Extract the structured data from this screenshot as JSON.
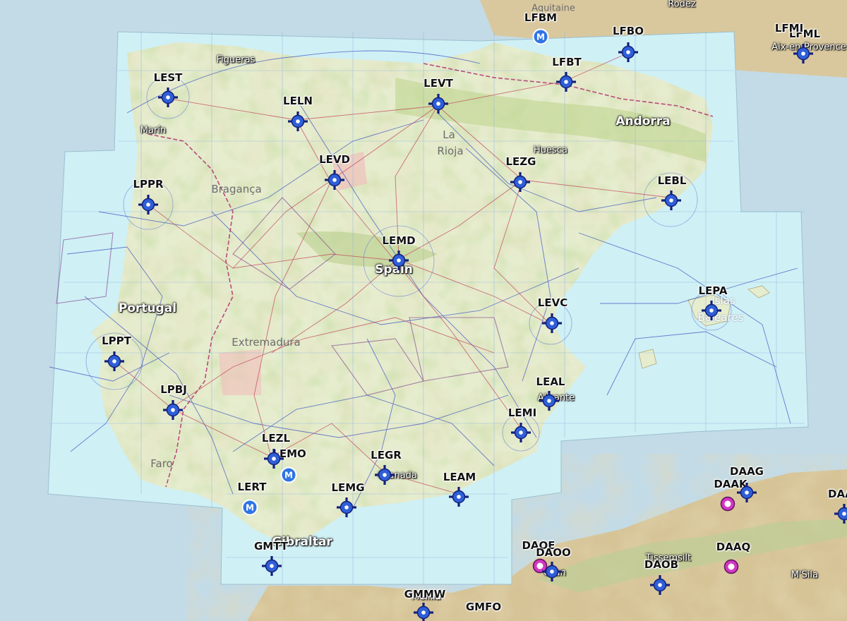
{
  "colors": {
    "sea": "#c3dbe6",
    "chart_sea": "#cff0f5",
    "chart_land": "#e3ebc9",
    "terrain": "#d8c595",
    "airport_blue": "#2f5fd8",
    "airport_magenta": "#d236c2",
    "country_border": "#b0306e",
    "airspace": "#3e55c2"
  },
  "airports": [
    {
      "id": "LEST",
      "icon": "airport-crosshair-icon"
    },
    {
      "id": "LELN",
      "icon": "airport-crosshair-icon"
    },
    {
      "id": "LEVT",
      "icon": "airport-crosshair-icon"
    },
    {
      "id": "LFBT",
      "icon": "airport-crosshair-icon"
    },
    {
      "id": "LFBO",
      "icon": "airport-crosshair-icon"
    },
    {
      "id": "LFBM",
      "icon": "military-airfield-icon"
    },
    {
      "id": "LFML",
      "icon": "airport-crosshair-icon"
    },
    {
      "id": "LFMI",
      "icon": ""
    },
    {
      "id": "LEVD",
      "icon": "airport-crosshair-icon"
    },
    {
      "id": "LEZG",
      "icon": "airport-crosshair-icon"
    },
    {
      "id": "LEBL",
      "icon": "airport-crosshair-icon"
    },
    {
      "id": "LPPR",
      "icon": "airport-crosshair-icon"
    },
    {
      "id": "LEMD",
      "icon": "airport-crosshair-icon"
    },
    {
      "id": "LEPA",
      "icon": "airport-crosshair-icon"
    },
    {
      "id": "LEVC",
      "icon": "airport-crosshair-icon"
    },
    {
      "id": "LPPT",
      "icon": "airport-crosshair-icon"
    },
    {
      "id": "LEAL",
      "icon": "airport-crosshair-icon"
    },
    {
      "id": "LPBJ",
      "icon": "airport-crosshair-icon"
    },
    {
      "id": "LEMI",
      "icon": "airport-crosshair-icon"
    },
    {
      "id": "LEZL",
      "icon": "airport-crosshair-icon"
    },
    {
      "id": "LEMO",
      "icon": "military-airfield-icon"
    },
    {
      "id": "LEGR",
      "icon": "airport-crosshair-icon"
    },
    {
      "id": "LEAM",
      "icon": "airport-crosshair-icon"
    },
    {
      "id": "LERT",
      "icon": "military-airfield-icon"
    },
    {
      "id": "LEMG",
      "icon": "airport-crosshair-icon"
    },
    {
      "id": "GMTT",
      "icon": "airport-crosshair-icon"
    },
    {
      "id": "DAOE",
      "icon": "heliport-ring-icon"
    },
    {
      "id": "DAOO",
      "icon": "airport-crosshair-icon"
    },
    {
      "id": "DAAG",
      "icon": "airport-crosshair-icon"
    },
    {
      "id": "DAAK",
      "icon": "heliport-ring-icon"
    },
    {
      "id": "DAAQ",
      "icon": "heliport-ring-icon"
    },
    {
      "id": "DAOB",
      "icon": "airport-crosshair-icon"
    },
    {
      "id": "GMMW",
      "icon": "airport-crosshair-icon"
    },
    {
      "id": "GMFO",
      "icon": "airport-crosshair-icon"
    },
    {
      "id": "DAAE",
      "icon": "airport-crosshair-icon"
    }
  ],
  "countries": [
    "Spain",
    "Portugal",
    "Andorra",
    "Gibraltar"
  ],
  "places": [
    "Aquitaine",
    "Rodez",
    "Aix-en-Provence",
    "Figueras",
    "Marín",
    "Huesca",
    "Alicante",
    "Granada",
    "Oran",
    "Melilla",
    "Tissemsilt",
    "M'Sila"
  ],
  "regions": [
    "La",
    "Rioja",
    "Bragança",
    "Extremadura",
    "Faro",
    "Islas",
    "Baleares"
  ]
}
